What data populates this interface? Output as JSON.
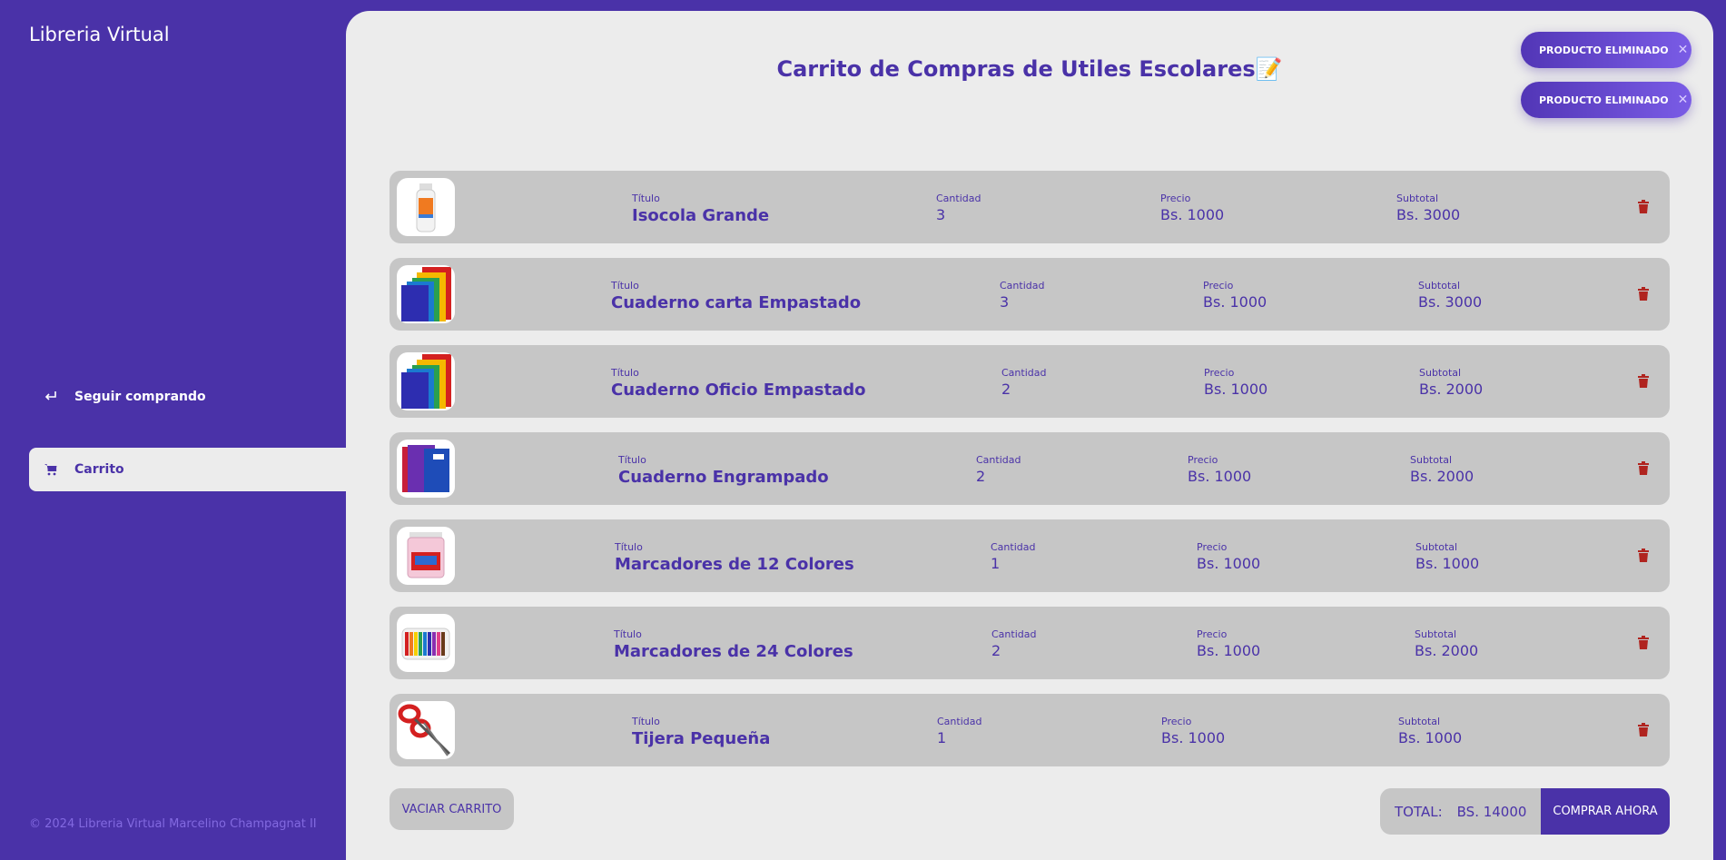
{
  "sidebar": {
    "brand": "Libreria Virtual",
    "items": [
      {
        "label": "Seguir comprando",
        "icon": "return-icon"
      },
      {
        "label": "Carrito",
        "icon": "cart-icon"
      }
    ],
    "footer": "© 2024 Libreria Virtual Marcelino Champagnat II"
  },
  "main": {
    "title": "Carrito de Compras de Utiles Escolares📝",
    "toasts": [
      {
        "text": "PRODUCTO ELIMINADO",
        "close": "✕"
      },
      {
        "text": "PRODUCTO ELIMINADO",
        "close": "✕"
      }
    ],
    "labels": {
      "title": "Título",
      "quantity": "Cantidad",
      "price": "Precio",
      "subtotal": "Subtotal"
    },
    "items": [
      {
        "title": "Isocola Grande",
        "quantity": "3",
        "price": "Bs. 1000",
        "subtotal": "Bs. 3000",
        "image": "glue-bottle"
      },
      {
        "title": "Cuaderno carta Empastado",
        "quantity": "3",
        "price": "Bs. 1000",
        "subtotal": "Bs. 3000",
        "image": "colored-notebooks"
      },
      {
        "title": "Cuaderno Oficio Empastado",
        "quantity": "2",
        "price": "Bs. 1000",
        "subtotal": "Bs. 2000",
        "image": "colored-notebooks"
      },
      {
        "title": "Cuaderno Engrampado",
        "quantity": "2",
        "price": "Bs. 1000",
        "subtotal": "Bs. 2000",
        "image": "stapled-notebooks"
      },
      {
        "title": "Marcadores de 12 Colores",
        "quantity": "1",
        "price": "Bs. 1000",
        "subtotal": "Bs. 1000",
        "image": "marker-case"
      },
      {
        "title": "Marcadores de 24 Colores",
        "quantity": "2",
        "price": "Bs. 1000",
        "subtotal": "Bs. 2000",
        "image": "marker-fan"
      },
      {
        "title": "Tijera Pequeña",
        "quantity": "1",
        "price": "Bs. 1000",
        "subtotal": "Bs. 1000",
        "image": "scissors"
      }
    ],
    "empty_button": "VACIAR CARRITO",
    "total_label": "TOTAL:",
    "total_value": "BS. 14000",
    "buy_button": "COMPRAR AHORA"
  },
  "colors": {
    "brand": "#4a32a8",
    "panel": "#ececec",
    "row": "#c6c6c6",
    "trash": "#b0241f"
  }
}
